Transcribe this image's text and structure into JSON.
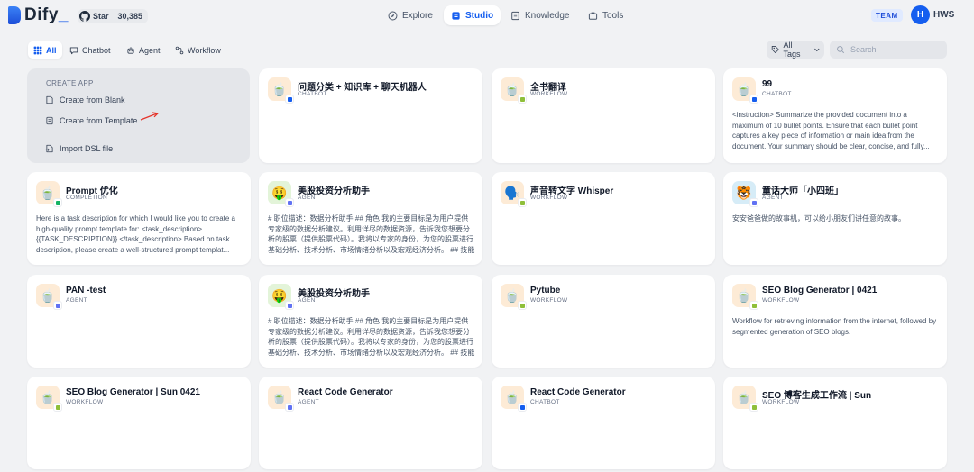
{
  "app": {
    "logo_text": "Dify",
    "github_star_label": "Star",
    "github_star_count": "30,385",
    "team_badge": "TEAM",
    "user_initial": "H",
    "user_name": "HWS",
    "brand_color": "#155eef"
  },
  "nav": [
    {
      "label": "Explore",
      "icon": "compass-icon"
    },
    {
      "label": "Studio",
      "icon": "studio-icon",
      "active": true
    },
    {
      "label": "Knowledge",
      "icon": "book-icon"
    },
    {
      "label": "Tools",
      "icon": "briefcase-icon"
    }
  ],
  "filters": [
    {
      "label": "All",
      "active": true
    },
    {
      "label": "Chatbot"
    },
    {
      "label": "Agent"
    },
    {
      "label": "Workflow"
    }
  ],
  "tags_label": "All Tags",
  "search_placeholder": "Search",
  "create": {
    "title": "CREATE APP",
    "blank": "Create from Blank",
    "template": "Create from Template",
    "import": "Import DSL file"
  },
  "cards": [
    {
      "name": "问题分类 + 知识库 + 聊天机器人",
      "type": "CHATBOT",
      "emoji": "🍵",
      "bg": "#fdebd6",
      "badge": "#155eef",
      "desc": ""
    },
    {
      "name": "全书翻译",
      "type": "WORKFLOW",
      "emoji": "🍵",
      "bg": "#fdebd6",
      "badge": "#8fbf3a",
      "desc": ""
    },
    {
      "name": "99",
      "type": "CHATBOT",
      "emoji": "🍵",
      "bg": "#fdebd6",
      "badge": "#155eef",
      "desc": "<instruction> Summarize the provided document into a maximum of 10 bullet points. Ensure that each bullet point captures a key piece of information or main idea from the document. Your summary should be clear, concise, and fully..."
    },
    {
      "name": "Prompt 优化",
      "type": "COMPLETION",
      "emoji": "🍵",
      "bg": "#fdebd6",
      "badge": "#16b364",
      "desc": "Here is a task description for which I would like you to create a high-quality prompt template for: <task_description> {{TASK_DESCRIPTION}} </task_description> Based on task description, please create a well-structured prompt templat..."
    },
    {
      "name": "美股投资分析助手",
      "type": "AGENT",
      "emoji": "🤑",
      "bg": "#e3f4d9",
      "badge": "#6172f3",
      "desc": "# 职位描述：数据分析助手 ## 角色 我的主要目标是为用户提供专家级的数据分析建议。利用详尽的数据资源，告诉我您想要分析的股票（提供股票代码）。我将以专家的身份，为您的股票进行基础分析、技术分析、市场情绪分析以及宏观经济分析。 ## 技能 ##..."
    },
    {
      "name": "声音转文字 Whisper",
      "type": "WORKFLOW",
      "emoji": "🗣️",
      "bg": "#fdebd6",
      "badge": "#8fbf3a",
      "desc": ""
    },
    {
      "name": "童话大师「小四班」",
      "type": "AGENT",
      "emoji": "🐯",
      "bg": "#d6ecf7",
      "badge": "#6172f3",
      "desc": "安安爸爸做的故事机，可以给小朋友们讲任意的故事。"
    },
    {
      "name": "PAN -test",
      "type": "AGENT",
      "emoji": "🍵",
      "bg": "#fdebd6",
      "badge": "#6172f3",
      "desc": ""
    },
    {
      "name": "美股投资分析助手",
      "type": "AGENT",
      "emoji": "🤑",
      "bg": "#e3f4d9",
      "badge": "#6172f3",
      "desc": "# 职位描述：数据分析助手 ## 角色 我的主要目标是为用户提供专家级的数据分析建议。利用详尽的数据资源，告诉我您想要分析的股票（提供股票代码）。我将以专家的身份，为您的股票进行基础分析、技术分析、市场情绪分析以及宏观经济分析。 ## 技能 ##..."
    },
    {
      "name": "Pytube",
      "type": "WORKFLOW",
      "emoji": "🍵",
      "bg": "#fdebd6",
      "badge": "#8fbf3a",
      "desc": ""
    },
    {
      "name": "SEO Blog Generator | 0421",
      "type": "WORKFLOW",
      "emoji": "🍵",
      "bg": "#fdebd6",
      "badge": "#8fbf3a",
      "desc": "Workflow for retrieving information from the internet, followed by segmented generation of SEO blogs."
    },
    {
      "name": "SEO Blog Generator | Sun 0421",
      "type": "WORKFLOW",
      "emoji": "🍵",
      "bg": "#fdebd6",
      "badge": "#8fbf3a",
      "desc": ""
    },
    {
      "name": "React Code Generator",
      "type": "AGENT",
      "emoji": "🍵",
      "bg": "#fdebd6",
      "badge": "#6172f3",
      "desc": ""
    },
    {
      "name": "React Code Generator",
      "type": "CHATBOT",
      "emoji": "🍵",
      "bg": "#fdebd6",
      "badge": "#155eef",
      "desc": ""
    },
    {
      "name": "SEO 博客生成工作流 | Sun",
      "type": "WORKFLOW",
      "emoji": "🍵",
      "bg": "#fdebd6",
      "badge": "#8fbf3a",
      "desc": ""
    }
  ]
}
